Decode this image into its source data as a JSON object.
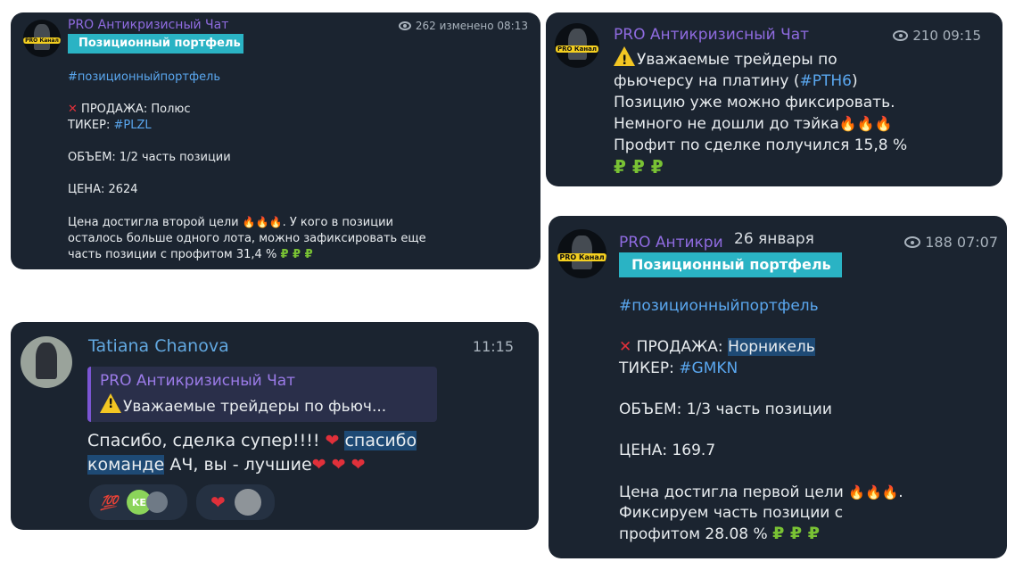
{
  "card1": {
    "avatar_text": "PRO Канал",
    "sender": "PRO Антикризисный Чат",
    "views": "262",
    "edited": "изменено 08:13",
    "tag_bar": "Позиционный портфель",
    "hashtag": "#позиционныйпортфель",
    "sale_label": "ПРОДАЖА: Полюс",
    "ticker_label": "ТИКЕР: ",
    "ticker": "#PLZL",
    "volume": "ОБЪЕМ: 1/2 часть позиции",
    "price": "ЦЕНА: 2624",
    "line1a": "Цена достигла второй цели",
    "line1b": ". У кого в позиции",
    "line2": "осталось больше одного лота, можно зафиксировать еще",
    "line3": "часть позиции с профитом 31,4 %",
    "flames": "🔥🔥🔥",
    "money": "₽ ₽ ₽"
  },
  "card2": {
    "avatar_text": "PRO Канал",
    "sender": "PRO Антикризисный Чат",
    "views": "210",
    "time": "09:15",
    "line1": "Уважаемые трейдеры по",
    "line2a": "фьючерсу на платину (",
    "line2_link": "#PTH6",
    "line2b": ")",
    "line3": "Позицию уже можно фиксировать.",
    "line4": "Немного не дошли до тэйка",
    "line5": "Профит по сделке получился 15,8 %",
    "flames": "🔥🔥🔥",
    "money": "₽ ₽ ₽"
  },
  "card3": {
    "sender": "Tatiana Chanova",
    "time": "11:15",
    "quote_sender": "PRO Антикризисный Чат",
    "quote_text": "Уважаемые трейдеры по фьюч...",
    "line1a": "Спасибо, сделка супер!!!! ",
    "line1_hl": "спасибо",
    "line2_hl": "команде",
    "line2b": " АЧ, вы - лучшие",
    "heart": "❤",
    "hearts": "❤ ❤ ❤",
    "reaction1": "💯",
    "reaction1_avatar": "KE",
    "reaction2": "❤"
  },
  "card4": {
    "avatar_text": "PRO Канал",
    "sender": "PRO Антикри",
    "date": "26 января",
    "views": "188",
    "time": "07:07",
    "tag_bar": "Позиционный портфель",
    "hashtag": "#позиционныйпортфель",
    "sale_label": "ПРОДАЖА: ",
    "sale_hl": "Норникель",
    "ticker_label": "ТИКЕР: ",
    "ticker": "#GMKN",
    "volume": "ОБЪЕМ: 1/3 часть позиции",
    "price": "ЦЕНА: 169.7",
    "line1": "Цена достигла первой цели",
    "line1_end": ".",
    "line2": "Фиксируем  часть позиции с",
    "line3": "профитом 28.08 %",
    "flames": "🔥🔥🔥",
    "money": "₽ ₽ ₽"
  }
}
